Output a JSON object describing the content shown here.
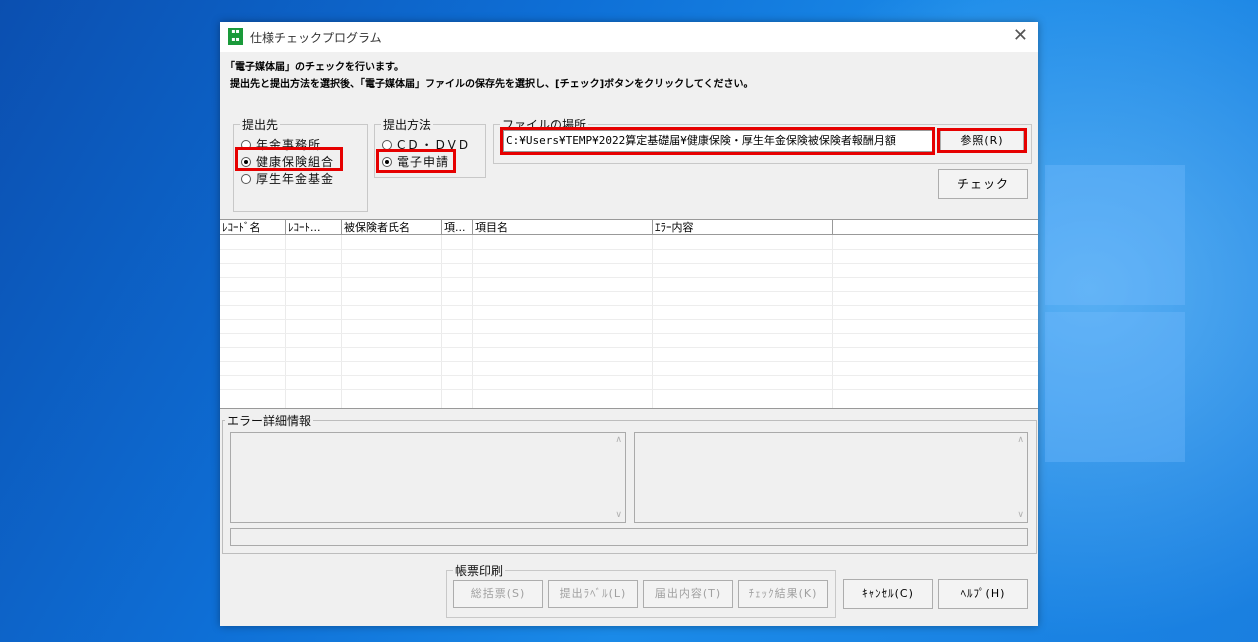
{
  "window": {
    "title": "仕様チェックプログラム",
    "icon": "app-green-icon"
  },
  "intro": {
    "line1": "「電子媒体届」のチェックを行います。",
    "line2": "提出先と提出方法を選択後、「電子媒体届」ファイルの保存先を選択し、[チェック]ボタンをクリックしてください。"
  },
  "submit_to": {
    "legend": "提出先",
    "options": [
      {
        "label": "年金事務所",
        "selected": false
      },
      {
        "label": "健康保険組合",
        "selected": true
      },
      {
        "label": "厚生年金基金",
        "selected": false
      }
    ]
  },
  "method": {
    "legend": "提出方法",
    "options": [
      {
        "label": "CD・DVD",
        "selected": false
      },
      {
        "label": "電子申請",
        "selected": true
      }
    ]
  },
  "file": {
    "legend": "ファイルの場所",
    "path": "C:¥Users¥TEMP¥2022算定基礎届¥健康保険・厚生年金保険被保険者報酬月額",
    "browse_label": "参照(R)"
  },
  "check_label": "チェック",
  "grid": {
    "columns": [
      "ﾚｺｰﾄﾞ名",
      "ﾚｺｰﾄ...",
      "被保険者氏名",
      "項...",
      "項目名",
      "ｴﾗｰ内容",
      ""
    ],
    "rows": []
  },
  "error_detail": {
    "legend": "エラー詳細情報"
  },
  "print": {
    "legend": "帳票印刷",
    "buttons": [
      "総括票(S)",
      "提出ﾗﾍﾞﾙ(L)",
      "届出内容(T)",
      "ﾁｪｯｸ結果(K)"
    ]
  },
  "cancel_label": "ｷｬﾝｾﾙ(C)",
  "help_label": "ﾍﾙﾌﾟ(H)",
  "colors": {
    "highlight": "#e60000",
    "window_bg": "#f0f0f0",
    "desktop": "#0e6fd6"
  }
}
